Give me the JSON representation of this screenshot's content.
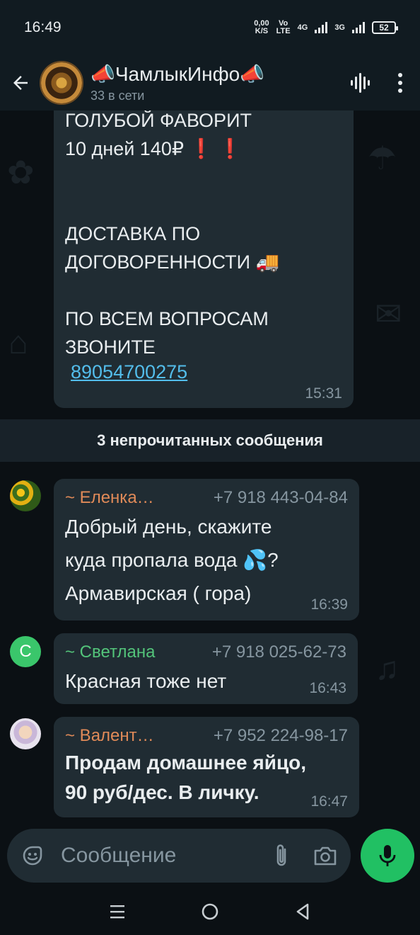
{
  "status_bar": {
    "time": "16:49",
    "speed_value": "0,00",
    "speed_unit": "K/S",
    "volte_top": "Vo",
    "volte_bottom": "LTE",
    "net1": "4G",
    "net2": "3G",
    "battery": "52"
  },
  "header": {
    "title": "📣ЧамлыкИнфо📣",
    "subtitle": "33 в сети"
  },
  "first_message": {
    "text": "ГОЛУБОЙ ФАВОРИТ\n10 дней 140₽ ❗ ❗\n\n\nДОСТАВКА ПО\nДОГОВОРЕННОСТИ 🚚\n\nПО ВСЕМ ВОПРОСАМ\nЗВОНИТЕ",
    "phone": "89054700275",
    "time": "15:31"
  },
  "unread_banner": "3 непрочитанных сообщения",
  "messages": [
    {
      "sender": "~ Еленка…",
      "phone": "+7 918 443-04-84",
      "text": "Добрый день, скажите\nкуда пропала вода 💦?\nАрмавирская ( гора)",
      "time": "16:39"
    },
    {
      "avatar_letter": "С",
      "sender": "~ Светлана",
      "phone": "+7 918 025-62-73",
      "text": "Красная тоже нет",
      "time": "16:43"
    },
    {
      "sender": "~ Валент…",
      "phone": "+7 952 224-98-17",
      "text": "Продам домашнее яйцо,\n90 руб/дес. В личку.",
      "time": "16:47"
    }
  ],
  "input": {
    "placeholder": "Сообщение"
  },
  "colors": {
    "background": "#0b1014",
    "bubble": "#202c33",
    "accent_green": "#21c063",
    "link_blue": "#53bdeb",
    "sender_orange": "#e08a58",
    "sender_green": "#53c47a"
  }
}
